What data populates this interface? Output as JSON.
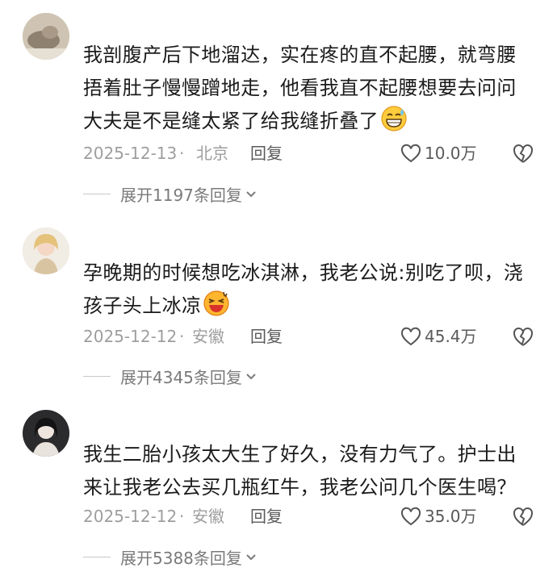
{
  "comments": [
    {
      "text": "我剖腹产后下地溜达，实在疼的直不起腰，就弯腰捂着肚子慢慢蹭地走，他看我直不起腰想要去问问大夫是不是缝太紧了给我缝折叠了",
      "emoji": "grinning-sweat-emoji",
      "date": "2025-12-13",
      "location": "北京",
      "reply_label": "回复",
      "likes": "10.0万",
      "expand_label": "展开1197条回复"
    },
    {
      "text": "孕晚期的时候想吃冰淇淋，我老公说:别吃了呗，浇孩子头上冰凉",
      "emoji": "laughing-sweat-emoji",
      "date": "2025-12-12",
      "location": "安徽",
      "reply_label": "回复",
      "likes": "45.4万",
      "expand_label": "展开4345条回复"
    },
    {
      "text": "我生二胎小孩太大生了好久，没有力气了。护士出来让我老公去买几瓶红牛，我老公问几个医生喝？",
      "date": "2025-12-12",
      "location": "安徽",
      "reply_label": "回复",
      "likes": "35.0万",
      "expand_label": "展开5388条回复"
    }
  ],
  "separator": "·"
}
